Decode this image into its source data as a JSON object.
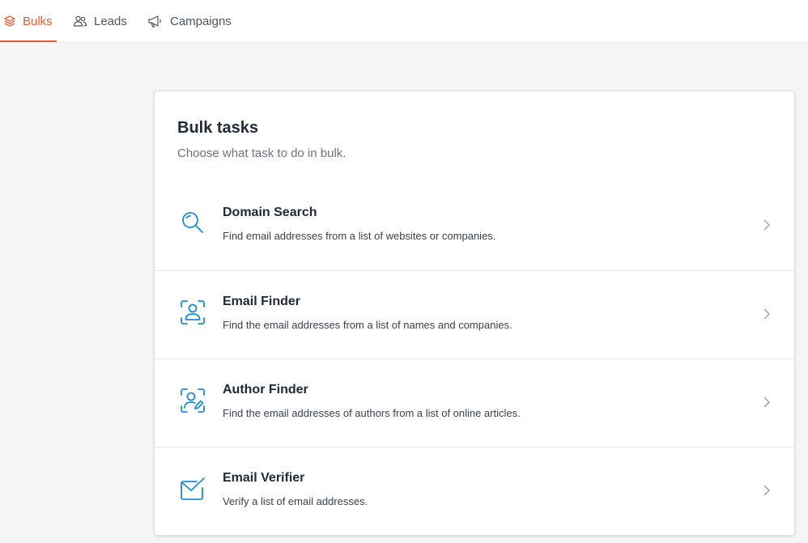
{
  "nav": {
    "tabs": [
      {
        "label": "Bulks",
        "icon": "layers-icon",
        "active": true
      },
      {
        "label": "Leads",
        "icon": "users-icon",
        "active": false
      },
      {
        "label": "Campaigns",
        "icon": "megaphone-icon",
        "active": false
      }
    ]
  },
  "card": {
    "title": "Bulk tasks",
    "subtitle": "Choose what task to do in bulk.",
    "tasks": [
      {
        "title": "Domain Search",
        "description": "Find email addresses from a list of websites or companies.",
        "icon": "search-icon"
      },
      {
        "title": "Email Finder",
        "description": "Find the email addresses from a list of names and companies.",
        "icon": "person-scan-icon"
      },
      {
        "title": "Author Finder",
        "description": "Find the email addresses of authors from a list of online articles.",
        "icon": "author-scan-icon"
      },
      {
        "title": "Email Verifier",
        "description": "Verify a list of email addresses.",
        "icon": "envelope-check-icon"
      }
    ]
  },
  "colors": {
    "accent": "#ef5b2d",
    "icon_blue": "#1a8ce0"
  }
}
